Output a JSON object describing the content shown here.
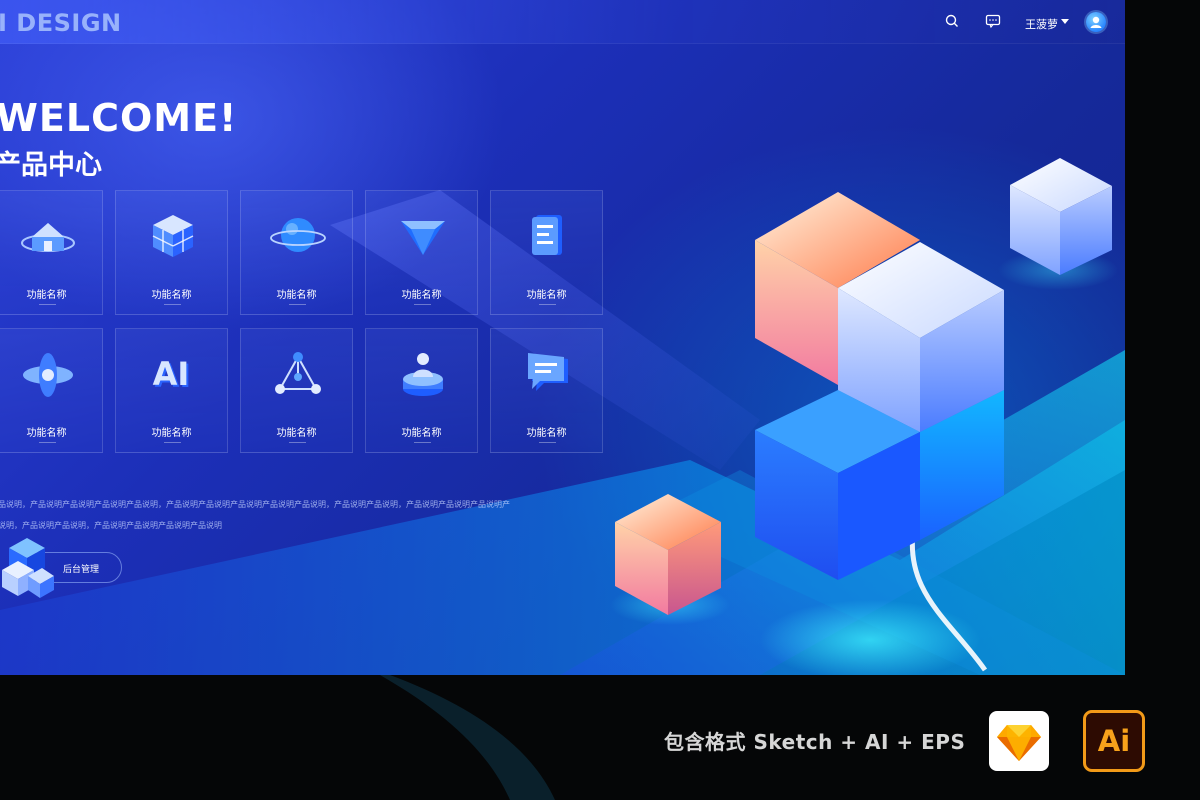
{
  "header": {
    "brand": "I DESIGN",
    "icons": [
      "search-icon",
      "message-icon"
    ],
    "user": {
      "name": "王菠萝",
      "avatar_icon": "user-avatar-icon"
    }
  },
  "hero": {
    "welcome": "WELCOME!",
    "subtitle": "产品中心"
  },
  "features": [
    {
      "label": "功能名称",
      "icon": "home-icon"
    },
    {
      "label": "功能名称",
      "icon": "blocks-icon"
    },
    {
      "label": "功能名称",
      "icon": "planet-icon"
    },
    {
      "label": "功能名称",
      "icon": "diamond-icon"
    },
    {
      "label": "功能名称",
      "icon": "document-icon"
    },
    {
      "label": "功能名称",
      "icon": "star-icon"
    },
    {
      "label": "功能名称",
      "icon": "ai-icon"
    },
    {
      "label": "功能名称",
      "icon": "network-icon"
    },
    {
      "label": "功能名称",
      "icon": "user-stand-icon"
    },
    {
      "label": "功能名称",
      "icon": "chat-icon"
    }
  ],
  "description": {
    "line1": "品说明，产品说明产品说明产品说明产品说明，产品说明产品说明产品说明产品说明产品说明，产品说明产品说明，产品说明产品说明产品说明产",
    "line2": "说明，产品说明产品说明，产品说明产品说明产品说明产品说明"
  },
  "admin": {
    "label": "后台管理",
    "icon": "cubes-icon"
  },
  "promo": {
    "text": "包含格式 Sketch + AI + EPS",
    "sketch_icon": "sketch-logo-icon",
    "ai_label": "Ai"
  },
  "colors": {
    "accent": "#2a86ff",
    "background": "#1c2fb8",
    "ai_orange": "#f29a18"
  }
}
